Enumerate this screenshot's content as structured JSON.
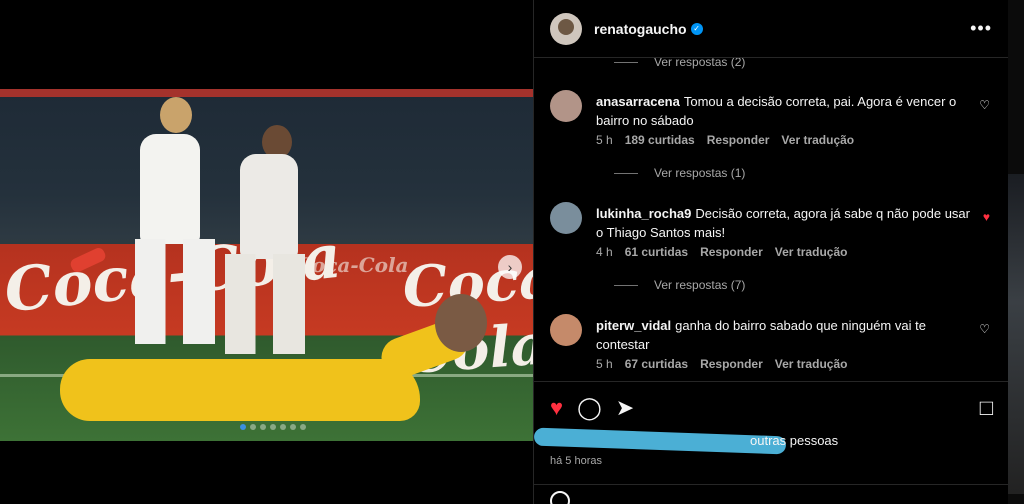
{
  "post": {
    "username": "renatogaucho",
    "more_label": "•••",
    "time_ago": "há 5 horas",
    "liked_by_tail": "outras pessoas",
    "carousel_total": 7,
    "carousel_current": 1
  },
  "comments": [
    {
      "username": "anasarracena",
      "text": "Tomou a decisão correta, pai. Agora é vencer o bairro no sábado",
      "time": "5 h",
      "likes": "189 curtidas",
      "reply_label": "Responder",
      "translate_label": "Ver tradução",
      "liked": false,
      "avatar_color": "#b29488"
    },
    {
      "username": "lukinha_rocha9",
      "text": "Decisão correta, agora já sabe q não pode usar o Thiago Santos mais!",
      "time": "4 h",
      "likes": "61 curtidas",
      "reply_label": "Responder",
      "translate_label": "Ver tradução",
      "liked": true,
      "avatar_color": "#7a8e9c"
    },
    {
      "username": "piterw_vidal",
      "text": "ganha do bairro sabado que ninguém vai te contestar",
      "time": "5 h",
      "likes": "67 curtidas",
      "reply_label": "Responder",
      "translate_label": "Ver tradução",
      "liked": false,
      "avatar_color": "#c58a6a"
    }
  ],
  "replies": {
    "top": "Ver respostas (2)",
    "after_first": "Ver respostas (1)",
    "after_second": "Ver respostas (7)"
  },
  "photo": {
    "ad_text_main": "Coca-Cola",
    "ad_text_small": "Coca-Cola"
  },
  "icons": {
    "like": "heart-icon",
    "comment": "comment-icon",
    "share": "share-icon",
    "save": "bookmark-icon",
    "verified": "verified-badge-icon"
  },
  "colors": {
    "like_red": "#ff3040",
    "verified_blue": "#0095f6",
    "muted": "#a8a8a8"
  }
}
